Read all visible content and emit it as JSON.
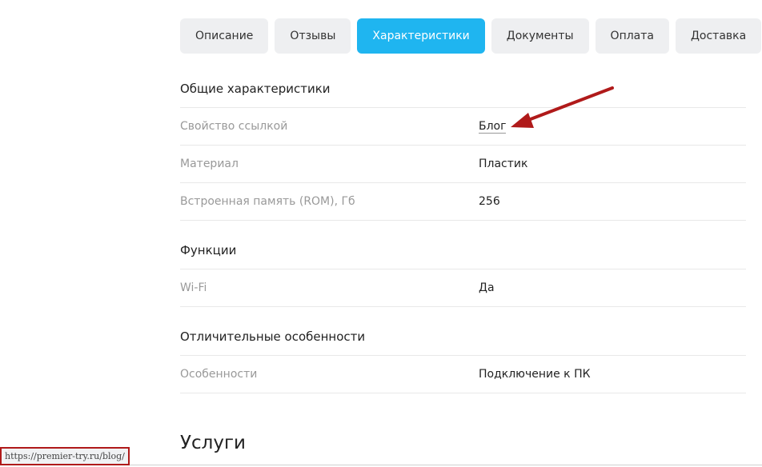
{
  "tabs": [
    {
      "label": "Описание",
      "active": false
    },
    {
      "label": "Отзывы",
      "active": false
    },
    {
      "label": "Характеристики",
      "active": true
    },
    {
      "label": "Документы",
      "active": false
    },
    {
      "label": "Оплата",
      "active": false
    },
    {
      "label": "Доставка",
      "active": false
    }
  ],
  "groups": [
    {
      "title": "Общие характеристики",
      "rows": [
        {
          "name": "Свойство ссылкой",
          "value": "Блог"
        },
        {
          "name": "Материал",
          "value": "Пластик"
        },
        {
          "name": "Встроенная память (ROM), Гб",
          "value": "256"
        }
      ]
    },
    {
      "title": "Функции",
      "rows": [
        {
          "name": "Wi-Fi",
          "value": "Да"
        }
      ]
    },
    {
      "title": "Отличительные особенности",
      "rows": [
        {
          "name": "Особенности",
          "value": "Подключение к ПК"
        }
      ]
    }
  ],
  "services_title": "Услуги",
  "status_url": "https://premier-try.ru/blog/",
  "colors": {
    "accent": "#1fb5f0",
    "annotation": "#b01a1a"
  }
}
